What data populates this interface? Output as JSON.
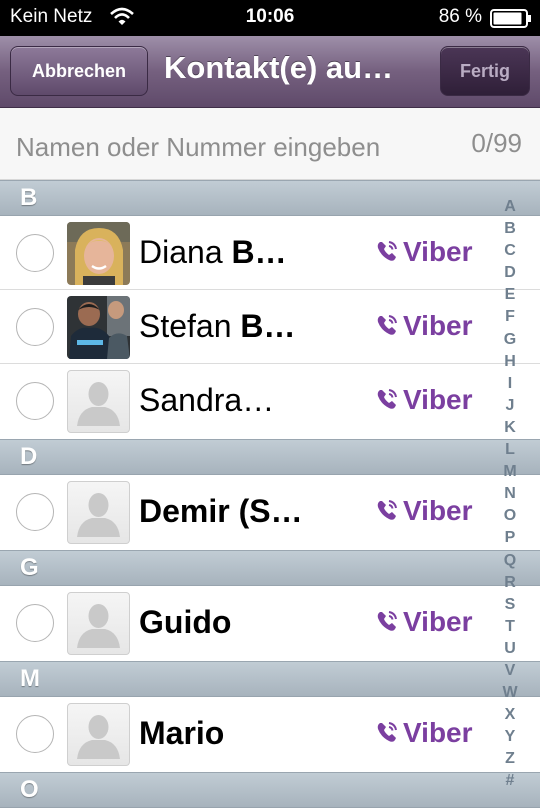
{
  "status_bar": {
    "carrier": "Kein Netz",
    "time": "10:06",
    "battery": "86 %"
  },
  "nav": {
    "cancel_label": "Abbrechen",
    "title": "Kontakt(e) au…",
    "done_label": "Fertig"
  },
  "search": {
    "placeholder": "Namen oder Nummer eingeben",
    "value": "",
    "count": "0/99"
  },
  "sections": [
    {
      "letter": "B",
      "contacts": [
        {
          "first": "Diana ",
          "last": "B…",
          "badge": "Viber",
          "avatar": "photo-diana"
        },
        {
          "first": "Stefan ",
          "last": "B…",
          "badge": "Viber",
          "avatar": "photo-stefan"
        },
        {
          "first": "Sandra…",
          "last": "",
          "badge": "Viber",
          "avatar": "placeholder"
        }
      ]
    },
    {
      "letter": "D",
      "contacts": [
        {
          "first": "",
          "last": "Demir (S…",
          "badge": "Viber",
          "avatar": "placeholder"
        }
      ]
    },
    {
      "letter": "G",
      "contacts": [
        {
          "first": "",
          "last": "Guido",
          "badge": "Viber",
          "avatar": "placeholder"
        }
      ]
    },
    {
      "letter": "M",
      "contacts": [
        {
          "first": "",
          "last": "Mario",
          "badge": "Viber",
          "avatar": "placeholder"
        }
      ]
    },
    {
      "letter": "O",
      "contacts": []
    }
  ],
  "index_letters": [
    "A",
    "B",
    "C",
    "D",
    "E",
    "F",
    "G",
    "H",
    "I",
    "J",
    "K",
    "L",
    "M",
    "N",
    "O",
    "P",
    "Q",
    "R",
    "S",
    "T",
    "U",
    "V",
    "W",
    "X",
    "Y",
    "Z",
    "#"
  ],
  "colors": {
    "nav_accent": "#75607f",
    "viber": "#7b3fa0",
    "section": "#b4bfc8"
  },
  "icons": {
    "wifi": "wifi-icon",
    "battery": "battery-icon",
    "viber": "viber-phone-icon",
    "avatar": "person-silhouette-icon"
  }
}
